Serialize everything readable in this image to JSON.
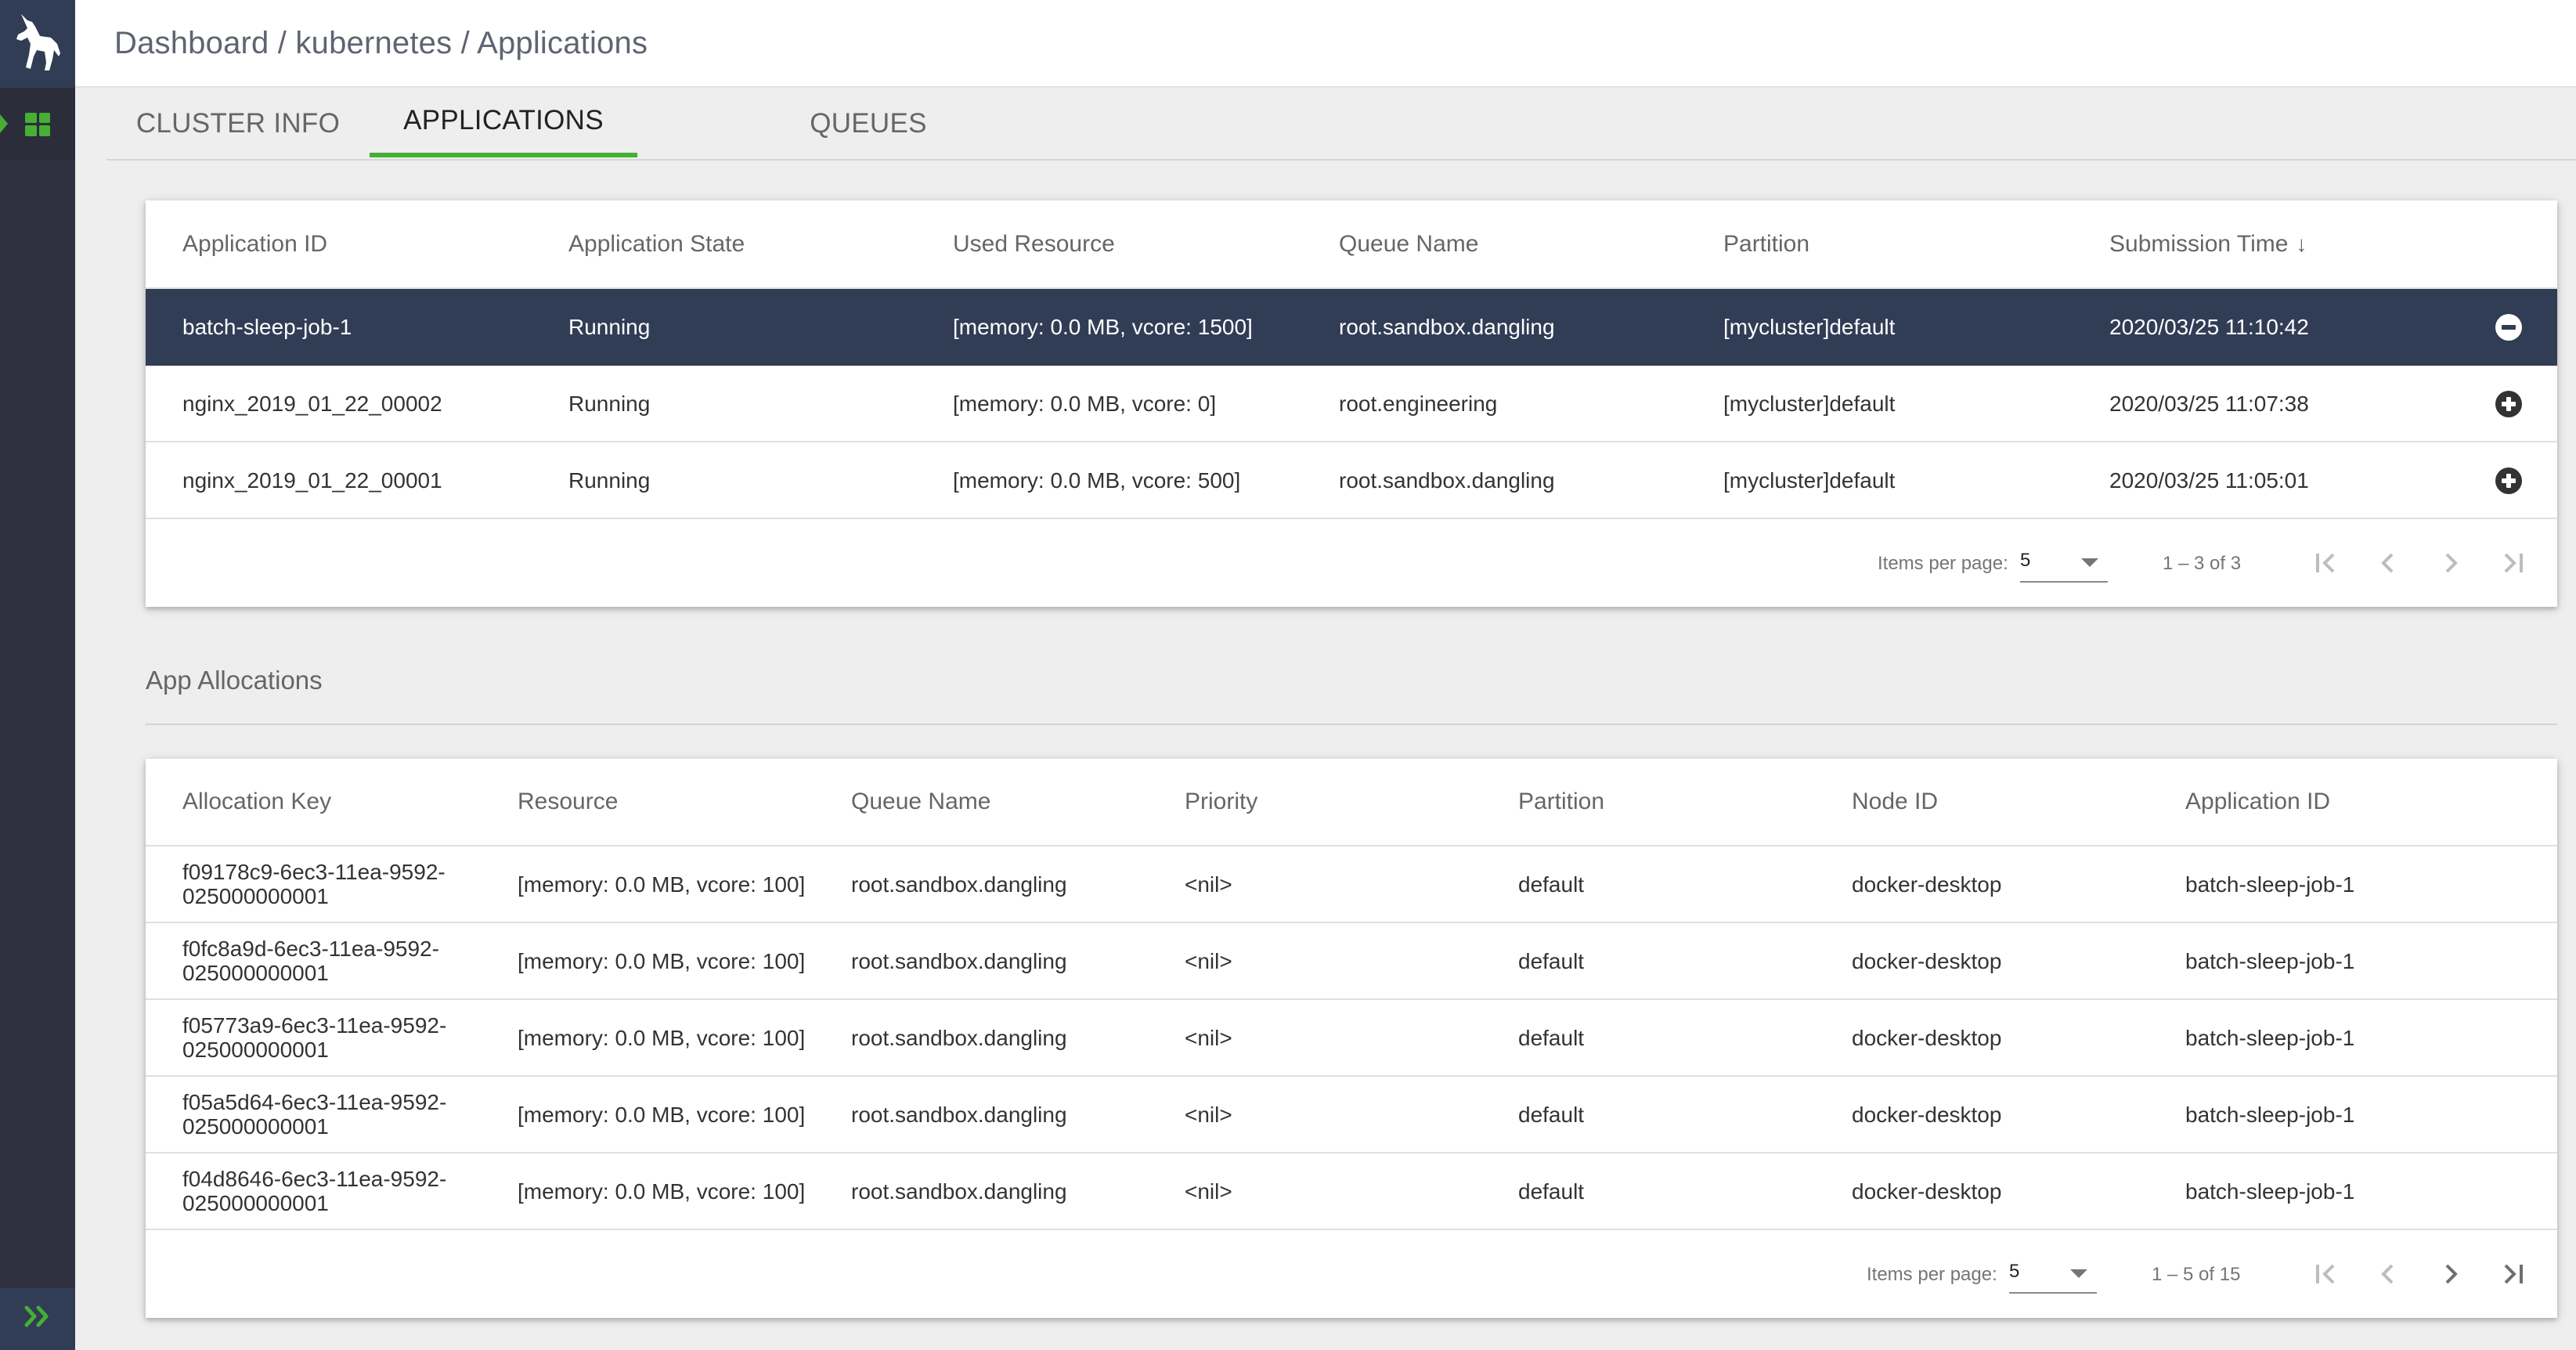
{
  "sidebar": {
    "logo_icon": "unicorn-logo-icon",
    "items": [
      {
        "name": "dashboard",
        "icon": "grid-icon",
        "active": true
      }
    ],
    "expand_icon": "double-chevron-right-icon",
    "expand_label": "»"
  },
  "header": {
    "breadcrumb": "Dashboard / kubernetes / Applications"
  },
  "tabs": [
    {
      "label": "CLUSTER INFO",
      "active": false
    },
    {
      "label": "APPLICATIONS",
      "active": true
    },
    {
      "label": "QUEUES",
      "active": false
    }
  ],
  "applications_table": {
    "columns": [
      "Application ID",
      "Application State",
      "Used Resource",
      "Queue Name",
      "Partition",
      "Submission Time"
    ],
    "sort": {
      "column": "Submission Time",
      "direction": "desc",
      "arrow": "↓"
    },
    "rows": [
      {
        "id": "batch-sleep-job-1",
        "state": "Running",
        "used_resource": "[memory: 0.0 MB, vcore: 1500]",
        "queue": "root.sandbox.dangling",
        "partition": "[mycluster]default",
        "submission_time": "2020/03/25 11:10:42",
        "selected": true,
        "toggle_icon": "minus-circle-icon"
      },
      {
        "id": "nginx_2019_01_22_00002",
        "state": "Running",
        "used_resource": "[memory: 0.0 MB, vcore: 0]",
        "queue": "root.engineering",
        "partition": "[mycluster]default",
        "submission_time": "2020/03/25 11:07:38",
        "selected": false,
        "toggle_icon": "plus-circle-icon"
      },
      {
        "id": "nginx_2019_01_22_00001",
        "state": "Running",
        "used_resource": "[memory: 0.0 MB, vcore: 500]",
        "queue": "root.sandbox.dangling",
        "partition": "[mycluster]default",
        "submission_time": "2020/03/25 11:05:01",
        "selected": false,
        "toggle_icon": "plus-circle-icon"
      }
    ],
    "paginator": {
      "items_per_page_label": "Items per page:",
      "items_per_page": "5",
      "range_label": "1 – 3 of 3",
      "first_enabled": false,
      "prev_enabled": false,
      "next_enabled": false,
      "last_enabled": false
    }
  },
  "allocations": {
    "title": "App Allocations",
    "columns": [
      "Allocation Key",
      "Resource",
      "Queue Name",
      "Priority",
      "Partition",
      "Node ID",
      "Application ID"
    ],
    "rows": [
      {
        "key": "f09178c9-6ec3-11ea-9592-025000000001",
        "resource": "[memory: 0.0 MB, vcore: 100]",
        "queue": "root.sandbox.dangling",
        "priority": "<nil>",
        "partition": "default",
        "node": "docker-desktop",
        "app_id": "batch-sleep-job-1"
      },
      {
        "key": "f0fc8a9d-6ec3-11ea-9592-025000000001",
        "resource": "[memory: 0.0 MB, vcore: 100]",
        "queue": "root.sandbox.dangling",
        "priority": "<nil>",
        "partition": "default",
        "node": "docker-desktop",
        "app_id": "batch-sleep-job-1"
      },
      {
        "key": "f05773a9-6ec3-11ea-9592-025000000001",
        "resource": "[memory: 0.0 MB, vcore: 100]",
        "queue": "root.sandbox.dangling",
        "priority": "<nil>",
        "partition": "default",
        "node": "docker-desktop",
        "app_id": "batch-sleep-job-1"
      },
      {
        "key": "f05a5d64-6ec3-11ea-9592-025000000001",
        "resource": "[memory: 0.0 MB, vcore: 100]",
        "queue": "root.sandbox.dangling",
        "priority": "<nil>",
        "partition": "default",
        "node": "docker-desktop",
        "app_id": "batch-sleep-job-1"
      },
      {
        "key": "f04d8646-6ec3-11ea-9592-025000000001",
        "resource": "[memory: 0.0 MB, vcore: 100]",
        "queue": "root.sandbox.dangling",
        "priority": "<nil>",
        "partition": "default",
        "node": "docker-desktop",
        "app_id": "batch-sleep-job-1"
      }
    ],
    "paginator": {
      "items_per_page_label": "Items per page:",
      "items_per_page": "5",
      "range_label": "1 – 5 of 15",
      "first_enabled": false,
      "prev_enabled": false,
      "next_enabled": true,
      "last_enabled": true
    }
  },
  "colors": {
    "accent": "#45b035",
    "sidebar": "#2f3140",
    "sidebar_header": "#313d55",
    "selected_row": "#313d55",
    "background": "#eeeeee"
  }
}
